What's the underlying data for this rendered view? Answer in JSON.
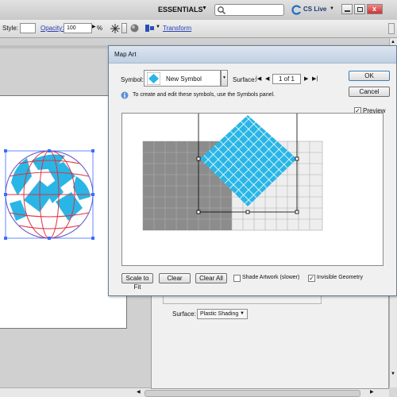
{
  "appbar": {
    "workspace": "ESSENTIALS",
    "search_placeholder": "",
    "cslive": "CS Live"
  },
  "controlbar": {
    "style_label": "Style:",
    "opacity_label": "Opacity:",
    "opacity_value": "100",
    "percent": "%",
    "transform": "Transform"
  },
  "dialog": {
    "title": "Map Art",
    "symbol_label": "Symbol:",
    "symbol_value": "New Symbol",
    "surface_label": "Surface:",
    "surface_value": "1 of 1",
    "info": "To create and edit these symbols, use the Symbols panel.",
    "ok": "OK",
    "cancel": "Cancel",
    "preview": "Preview",
    "preview_checked": true,
    "scale_to_fit": "Scale to Fit",
    "clear": "Clear",
    "clear_all": "Clear All",
    "shade_artwork": "Shade Artwork (slower)",
    "shade_checked": false,
    "invisible_geometry": "Invisible Geometry",
    "invisible_checked": true
  },
  "behind_dialog": {
    "surface_label": "Surface:",
    "surface_value": "Plastic Shading"
  },
  "colors": {
    "accent": "#29b6e6",
    "grid_dark": "#8c8c8c",
    "grid_light": "#eeeeee",
    "wire": "#e03040",
    "selection": "#3a6cff"
  },
  "icons": [
    "search-icon",
    "cs-live-icon",
    "minimize-icon",
    "restore-icon",
    "close-icon",
    "first-icon",
    "prev-icon",
    "next-icon",
    "last-icon",
    "info-icon"
  ]
}
